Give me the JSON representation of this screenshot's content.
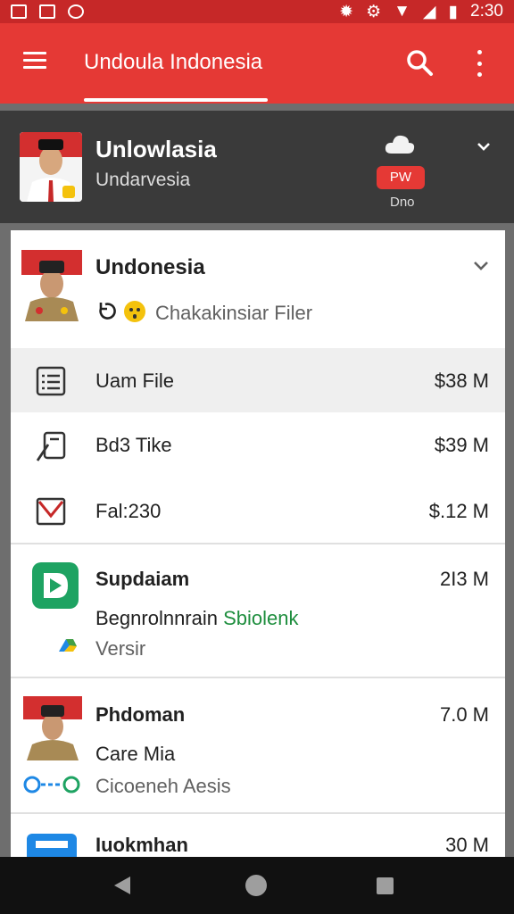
{
  "status_bar": {
    "time": "2:30"
  },
  "app_bar": {
    "title": "Undoula Indonesia"
  },
  "hero": {
    "name": "Unlowlasia",
    "subtitle": "Undarvesia",
    "pill": "PW",
    "pill_caption": "Dno"
  },
  "items": [
    {
      "title": "Undonesia",
      "subtitle": "Chakakinsiar Filer"
    },
    {
      "label": "Uam File",
      "value": "$38 M"
    },
    {
      "label": "Bd3 Tike",
      "value": "$39 M"
    },
    {
      "label": "Fal:230",
      "value": "$.12 M"
    },
    {
      "title": "Supdaiam",
      "value": "2I3 M",
      "line1": "Begnrolnnrain",
      "line1_link": "Sbiolenk",
      "line2": "Versir"
    },
    {
      "title": "Phdoman",
      "value": "7.0 M",
      "line1": "Care Mia",
      "line2": "Cicoeneh Aesis"
    },
    {
      "title": "Iuokmhan",
      "value": "30 M"
    }
  ],
  "colors": {
    "primary": "#e53935",
    "status_bar": "#c62828",
    "hero_bg": "#3a3a3a",
    "accent_green": "#1e8e3e"
  }
}
